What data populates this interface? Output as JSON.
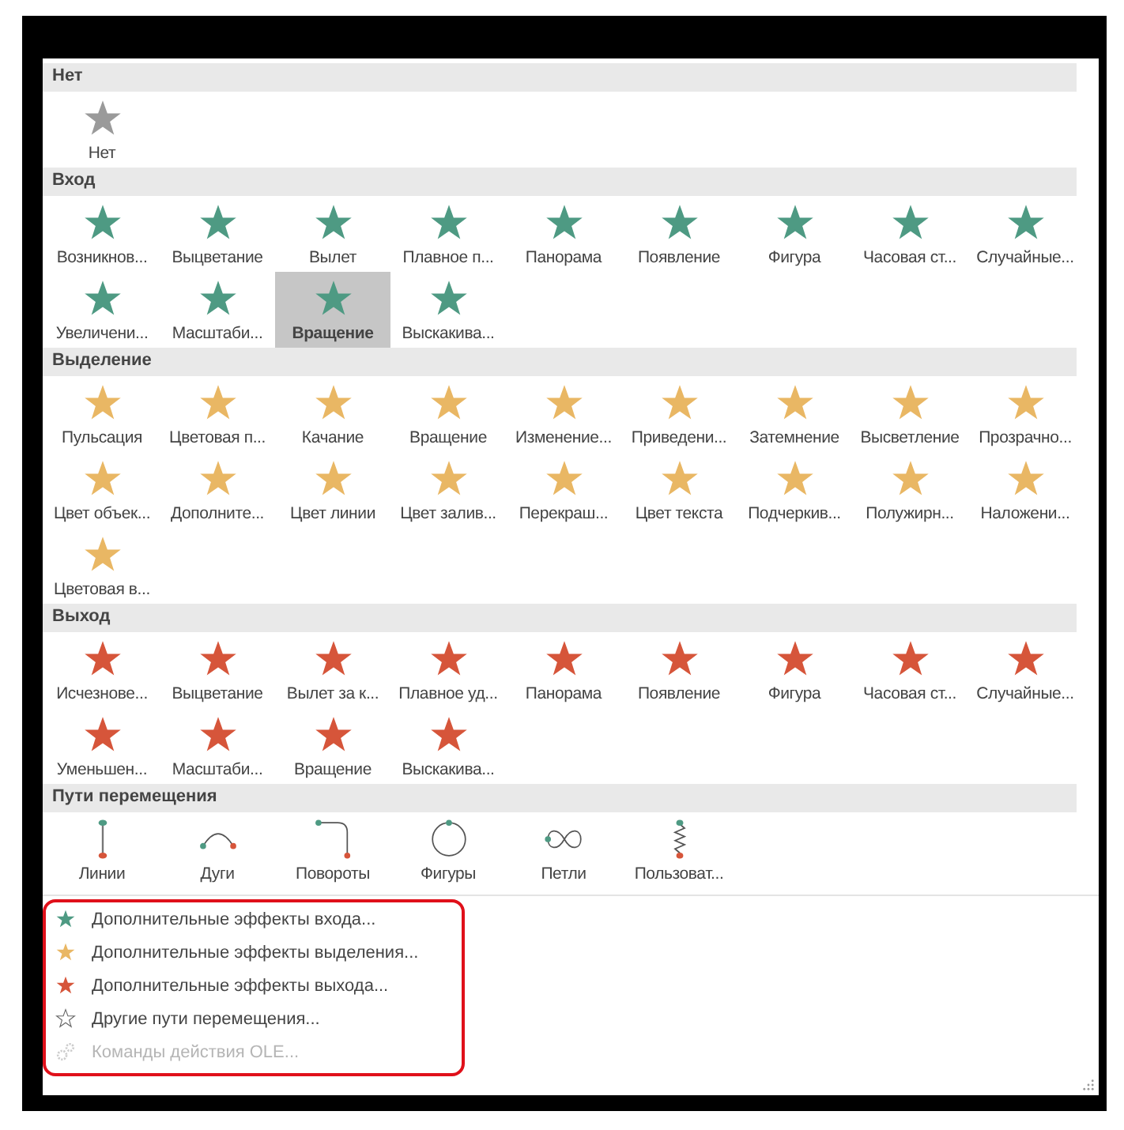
{
  "sections": [
    {
      "title": "Нет",
      "color": "#9a9a9a",
      "kind": "effects",
      "items": [
        {
          "label": "Нет",
          "selected": false
        }
      ]
    },
    {
      "title": "Вход",
      "color": "#4e9a83",
      "kind": "effects",
      "items": [
        {
          "label": "Возникнов...",
          "selected": false
        },
        {
          "label": "Выцветание",
          "selected": false
        },
        {
          "label": "Вылет",
          "selected": false
        },
        {
          "label": "Плавное п...",
          "selected": false
        },
        {
          "label": "Панорама",
          "selected": false
        },
        {
          "label": "Появление",
          "selected": false
        },
        {
          "label": "Фигура",
          "selected": false
        },
        {
          "label": "Часовая ст...",
          "selected": false
        },
        {
          "label": "Случайные...",
          "selected": false
        },
        {
          "label": "Увеличени...",
          "selected": false
        },
        {
          "label": "Масштаби...",
          "selected": false
        },
        {
          "label": "Вращение",
          "selected": true
        },
        {
          "label": "Выскакива...",
          "selected": false
        }
      ]
    },
    {
      "title": "Выделение",
      "color": "#e9b764",
      "kind": "effects",
      "items": [
        {
          "label": "Пульсация",
          "selected": false
        },
        {
          "label": "Цветовая п...",
          "selected": false
        },
        {
          "label": "Качание",
          "selected": false
        },
        {
          "label": "Вращение",
          "selected": false
        },
        {
          "label": "Изменение...",
          "selected": false
        },
        {
          "label": "Приведени...",
          "selected": false
        },
        {
          "label": "Затемнение",
          "selected": false
        },
        {
          "label": "Высветление",
          "selected": false
        },
        {
          "label": "Прозрачно...",
          "selected": false
        },
        {
          "label": "Цвет объек...",
          "selected": false
        },
        {
          "label": "Дополните...",
          "selected": false
        },
        {
          "label": "Цвет линии",
          "selected": false
        },
        {
          "label": "Цвет залив...",
          "selected": false
        },
        {
          "label": "Перекраш...",
          "selected": false
        },
        {
          "label": "Цвет текста",
          "selected": false
        },
        {
          "label": "Подчеркив...",
          "selected": false
        },
        {
          "label": "Полужирн...",
          "selected": false
        },
        {
          "label": "Наложени...",
          "selected": false
        },
        {
          "label": "Цветовая в...",
          "selected": false
        }
      ]
    },
    {
      "title": "Выход",
      "color": "#d6553a",
      "kind": "effects",
      "items": [
        {
          "label": "Исчезнове...",
          "selected": false
        },
        {
          "label": "Выцветание",
          "selected": false
        },
        {
          "label": "Вылет за к...",
          "selected": false
        },
        {
          "label": "Плавное уд...",
          "selected": false
        },
        {
          "label": "Панорама",
          "selected": false
        },
        {
          "label": "Появление",
          "selected": false
        },
        {
          "label": "Фигура",
          "selected": false
        },
        {
          "label": "Часовая ст...",
          "selected": false
        },
        {
          "label": "Случайные...",
          "selected": false
        },
        {
          "label": "Уменьшен...",
          "selected": false
        },
        {
          "label": "Масштаби...",
          "selected": false
        },
        {
          "label": "Вращение",
          "selected": false
        },
        {
          "label": "Выскакива...",
          "selected": false
        }
      ]
    },
    {
      "title": "Пути перемещения",
      "kind": "paths",
      "items": [
        {
          "label": "Линии",
          "kind": "line",
          "selected": false
        },
        {
          "label": "Дуги",
          "kind": "arc",
          "selected": false
        },
        {
          "label": "Повороты",
          "kind": "turn",
          "selected": false
        },
        {
          "label": "Фигуры",
          "kind": "circle",
          "selected": false
        },
        {
          "label": "Петли",
          "kind": "loop",
          "selected": false
        },
        {
          "label": "Пользоват...",
          "kind": "custom",
          "selected": false
        }
      ]
    }
  ],
  "menu": [
    {
      "label": "Дополнительные эффекты входа...",
      "kind": "star",
      "color": "#4e9a83",
      "disabled": false
    },
    {
      "label": "Дополнительные эффекты выделения...",
      "kind": "star",
      "color": "#e9b764",
      "disabled": false
    },
    {
      "label": "Дополнительные эффекты выхода...",
      "kind": "star",
      "color": "#d6553a",
      "disabled": false
    },
    {
      "label": "Другие пути перемещения...",
      "kind": "outline",
      "disabled": false
    },
    {
      "label": "Команды действия OLE...",
      "kind": "gears",
      "disabled": true
    }
  ]
}
